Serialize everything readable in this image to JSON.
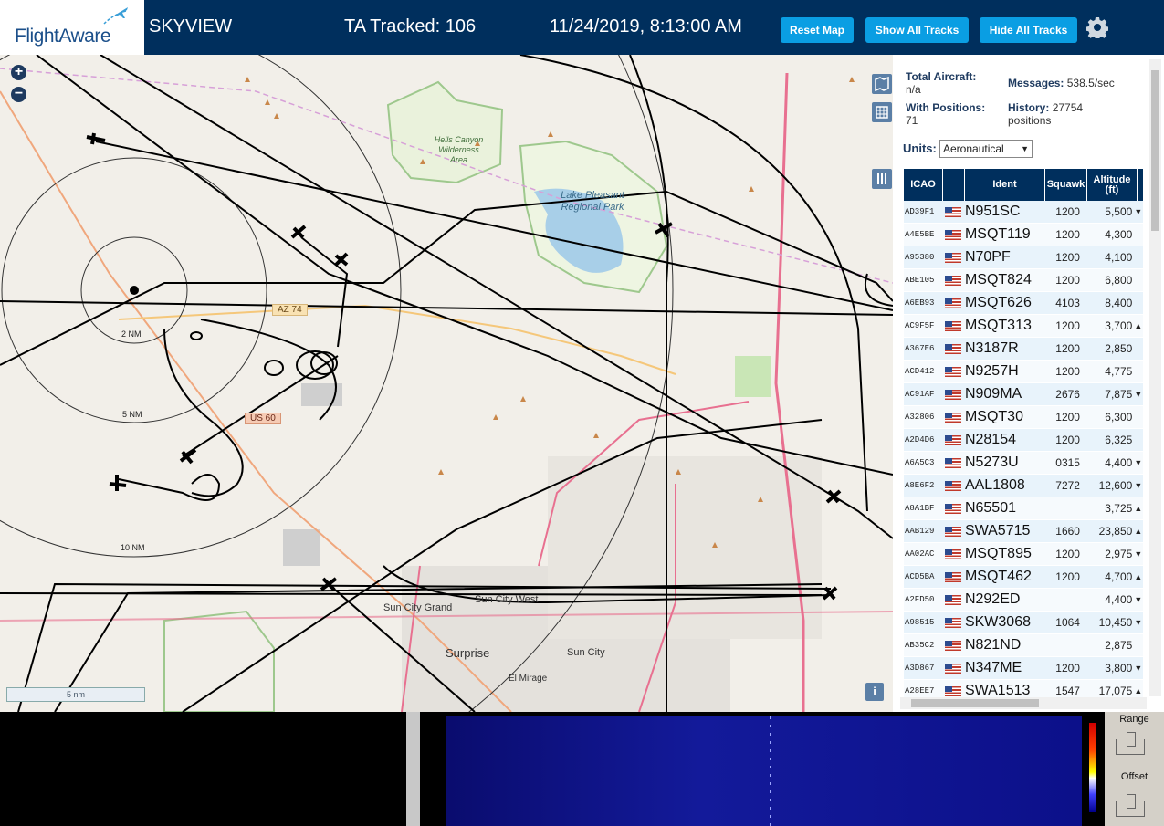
{
  "header": {
    "logo_text": "FlightAware",
    "app_name": "SKYVIEW",
    "ta_tracked": "TA Tracked: 106",
    "datetime": "11/24/2019, 8:13:00 AM",
    "buttons": {
      "reset_map": "Reset Map",
      "show_all": "Show All Tracks",
      "hide_all": "Hide All Tracks"
    },
    "settings_icon": "gear-icon"
  },
  "map": {
    "zoom_in": "+",
    "zoom_out": "−",
    "range_rings": [
      "2 NM",
      "5 NM",
      "10 NM"
    ],
    "labels": [
      "Hells Canyon Wilderness Area",
      "Lake Pleasant Regional Park",
      "Sun City Grand",
      "Sun City West",
      "Sun City",
      "Surprise",
      "El Mirage"
    ],
    "roads": [
      "AZ 74",
      "US 60"
    ],
    "scale": "5 nm",
    "info": "i"
  },
  "panel": {
    "total_aircraft_label": "Total Aircraft:",
    "total_aircraft": "n/a",
    "with_positions_label": "With Positions:",
    "with_positions": "71",
    "messages_label": "Messages:",
    "messages": "538.5/sec",
    "history_label": "History:",
    "history": "27754 positions",
    "units_label": "Units:",
    "units_value": "Aeronautical",
    "columns": {
      "icao": "ICAO",
      "ident": "Ident",
      "squawk": "Squawk",
      "altitude": "Altitude (ft)"
    },
    "rows": [
      {
        "icao": "AD39F1",
        "ident": "N951SC",
        "squawk": "1200",
        "alt": "5,500",
        "trend": "▼"
      },
      {
        "icao": "A4E5BE",
        "ident": "MSQT119",
        "squawk": "1200",
        "alt": "4,300",
        "trend": ""
      },
      {
        "icao": "A95380",
        "ident": "N70PF",
        "squawk": "1200",
        "alt": "4,100",
        "trend": ""
      },
      {
        "icao": "ABE105",
        "ident": "MSQT824",
        "squawk": "1200",
        "alt": "6,800",
        "trend": ""
      },
      {
        "icao": "A6EB93",
        "ident": "MSQT626",
        "squawk": "4103",
        "alt": "8,400",
        "trend": ""
      },
      {
        "icao": "AC9F5F",
        "ident": "MSQT313",
        "squawk": "1200",
        "alt": "3,700",
        "trend": "▲"
      },
      {
        "icao": "A367E6",
        "ident": "N3187R",
        "squawk": "1200",
        "alt": "2,850",
        "trend": ""
      },
      {
        "icao": "ACD412",
        "ident": "N9257H",
        "squawk": "1200",
        "alt": "4,775",
        "trend": ""
      },
      {
        "icao": "AC91AF",
        "ident": "N909MA",
        "squawk": "2676",
        "alt": "7,875",
        "trend": "▼"
      },
      {
        "icao": "A32806",
        "ident": "MSQT30",
        "squawk": "1200",
        "alt": "6,300",
        "trend": ""
      },
      {
        "icao": "A2D4D6",
        "ident": "N28154",
        "squawk": "1200",
        "alt": "6,325",
        "trend": ""
      },
      {
        "icao": "A6A5C3",
        "ident": "N5273U",
        "squawk": "0315",
        "alt": "4,400",
        "trend": "▼"
      },
      {
        "icao": "A8E6F2",
        "ident": "AAL1808",
        "squawk": "7272",
        "alt": "12,600",
        "trend": "▼"
      },
      {
        "icao": "A8A1BF",
        "ident": "N65501",
        "squawk": "",
        "alt": "3,725",
        "trend": "▲"
      },
      {
        "icao": "AAB129",
        "ident": "SWA5715",
        "squawk": "1660",
        "alt": "23,850",
        "trend": "▲"
      },
      {
        "icao": "AA02AC",
        "ident": "MSQT895",
        "squawk": "1200",
        "alt": "2,975",
        "trend": "▼"
      },
      {
        "icao": "ACD5BA",
        "ident": "MSQT462",
        "squawk": "1200",
        "alt": "4,700",
        "trend": "▲"
      },
      {
        "icao": "A2FD50",
        "ident": "N292ED",
        "squawk": "",
        "alt": "4,400",
        "trend": "▼"
      },
      {
        "icao": "A98515",
        "ident": "SKW3068",
        "squawk": "1064",
        "alt": "10,450",
        "trend": "▼"
      },
      {
        "icao": "AB35C2",
        "ident": "N821ND",
        "squawk": "",
        "alt": "2,875",
        "trend": ""
      },
      {
        "icao": "A3D867",
        "ident": "N347ME",
        "squawk": "1200",
        "alt": "3,800",
        "trend": "▼"
      },
      {
        "icao": "A28EE7",
        "ident": "SWA1513",
        "squawk": "1547",
        "alt": "17,075",
        "trend": "▲"
      }
    ]
  },
  "bottom": {
    "range_label": "Range",
    "offset_label": "Offset"
  }
}
